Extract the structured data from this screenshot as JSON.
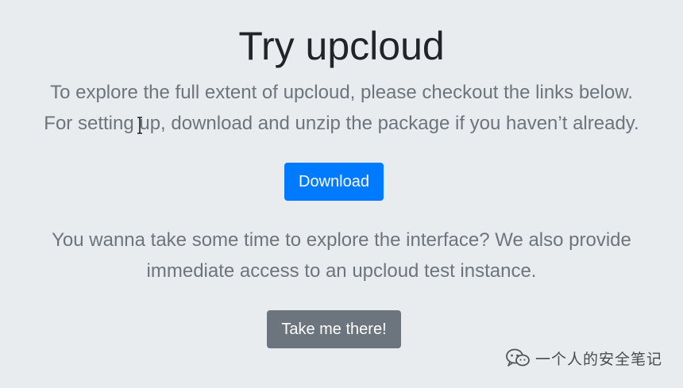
{
  "page": {
    "title": "Try upcloud",
    "intro_line1": "To explore the full extent of upcloud, please checkout the links below.",
    "intro_line2": "For setting up, download and unzip the package if you haven’t already.",
    "download_label": "Download",
    "explore_line1": "You wanna take some time to explore the interface? We also provide",
    "explore_line2": "immediate access to an upcloud test instance.",
    "try_label": "Take me there!"
  },
  "watermark": {
    "text": "一个人的安全笔记",
    "icon": "wechat-icon"
  },
  "colors": {
    "background": "#e9ecef",
    "primary": "#007bff",
    "secondary": "#6c757d",
    "heading": "#212529"
  }
}
